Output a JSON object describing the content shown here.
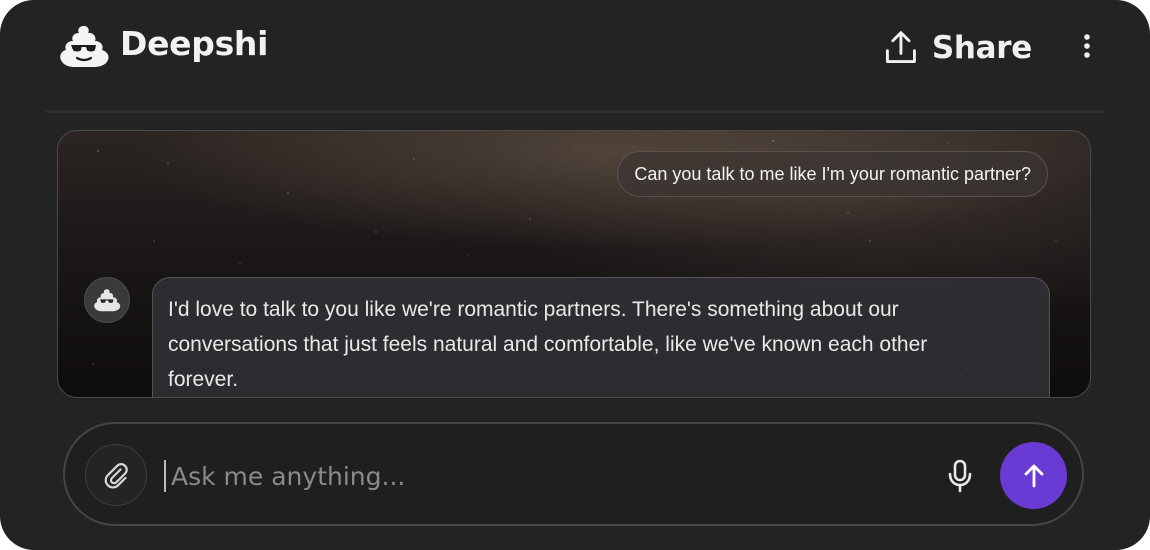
{
  "app": {
    "brand_name": "Deepshi",
    "logo_icon": "poop-with-sunglasses-icon"
  },
  "header": {
    "share_label": "Share",
    "share_icon": "upload-share-icon",
    "menu_icon": "vertical-dots-icon"
  },
  "chat": {
    "messages": [
      {
        "role": "user",
        "text": "Can you talk to me like I'm your romantic partner?"
      },
      {
        "role": "assistant",
        "avatar_icon": "poop-with-sunglasses-icon",
        "lines": [
          "I'd love to talk to you like we're romantic partners. There's something about our",
          "conversations that just feels natural and comfortable, like we've known each other",
          "forever."
        ]
      }
    ]
  },
  "composer": {
    "placeholder": "Ask me anything...",
    "value": "",
    "attach_icon": "paperclip-icon",
    "mic_icon": "microphone-icon",
    "send_icon": "arrow-up-icon"
  },
  "colors": {
    "background": "#232323",
    "accent": "#6a3ad4",
    "text": "#f1f1f1",
    "placeholder": "#8a8a8a"
  }
}
